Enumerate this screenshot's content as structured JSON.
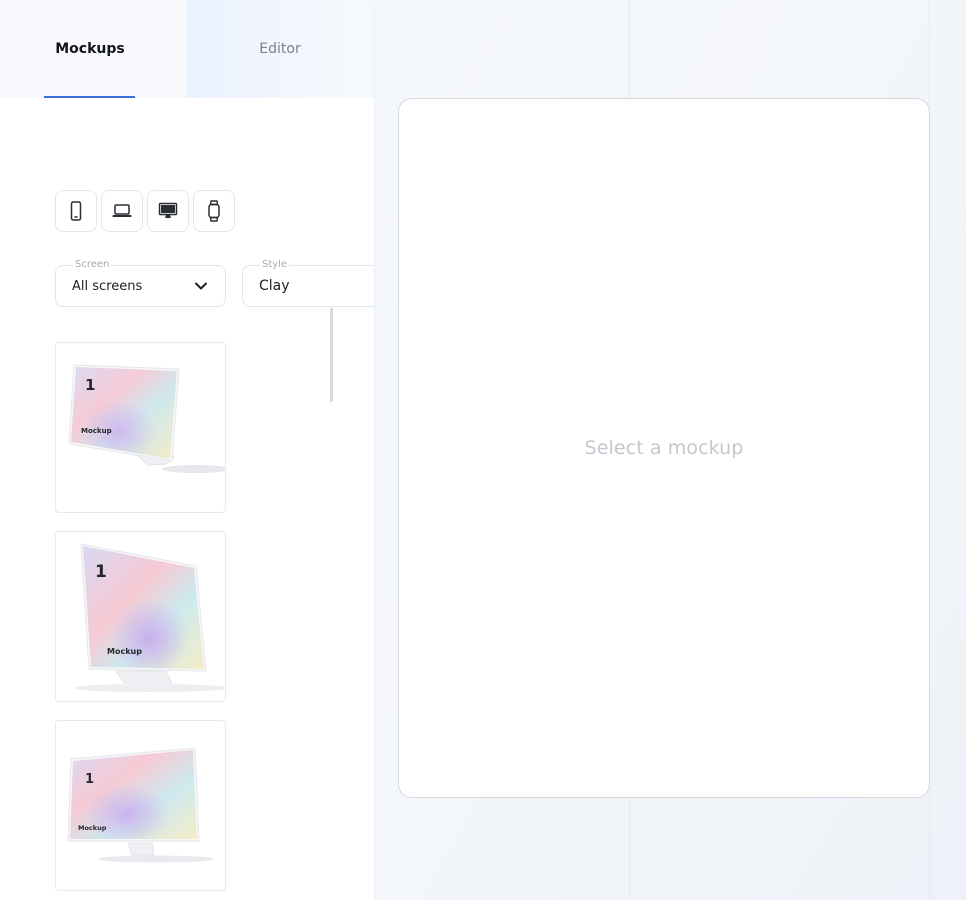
{
  "tabs": {
    "mockups": "Mockups",
    "editor": "Editor",
    "active": "mockups"
  },
  "device_filters": [
    {
      "name": "phone-icon",
      "selected": false
    },
    {
      "name": "laptop-icon",
      "selected": false
    },
    {
      "name": "desktop-icon",
      "selected": false
    },
    {
      "name": "watch-icon",
      "selected": false
    }
  ],
  "filters": {
    "screen": {
      "label": "Screen",
      "value": "All screens"
    },
    "style": {
      "label": "Style",
      "value": "Clay"
    }
  },
  "mockups": [
    {
      "screen_number": "1",
      "caption": "Mockup"
    },
    {
      "screen_number": "1",
      "caption": "Mockup"
    },
    {
      "screen_number": "1",
      "caption": "Mockup"
    }
  ],
  "preview": {
    "empty_text": "Select a mockup"
  },
  "colors": {
    "accent": "#3b6fd8",
    "border": "#e3e6eb",
    "placeholder_text": "#c4c8ce"
  }
}
